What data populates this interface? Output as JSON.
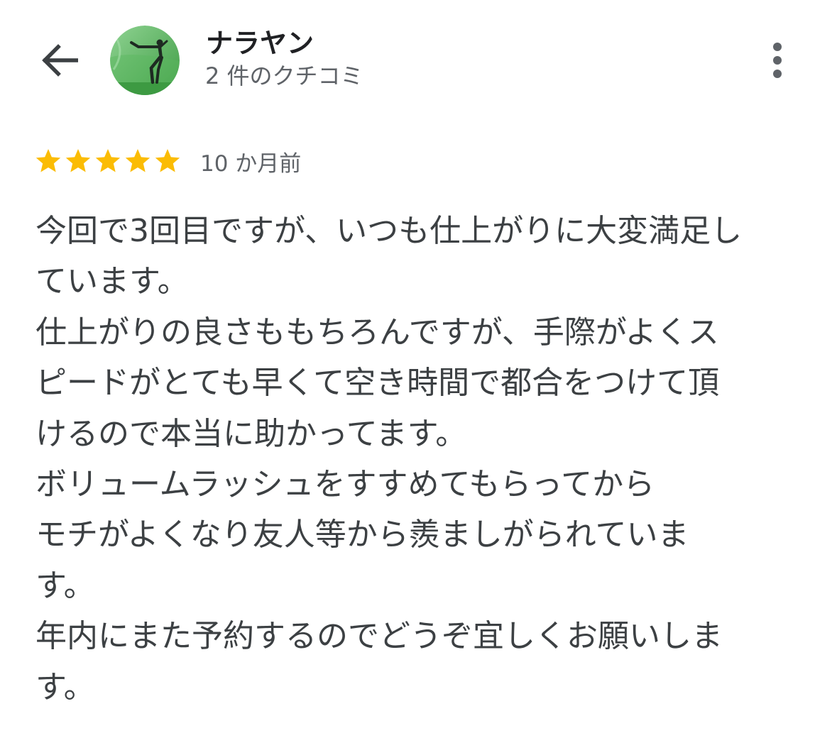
{
  "header": {
    "reviewer_name": "ナラヤン",
    "review_count": "2 件のクチコミ",
    "back_icon": "arrow-back-icon",
    "menu_icon": "more-vert-icon"
  },
  "review": {
    "rating": 5,
    "rating_max": 5,
    "star_color": "#fbbc04",
    "date": "10 か月前",
    "lines": [
      "今回で3回目ですが、いつも仕上がりに大変満足し",
      "ています。",
      "仕上がりの良さももちろんですが、手際がよくス",
      "ピードがとても早くて空き時間で都合をつけて頂",
      "けるので本当に助かってます。",
      "ボリュームラッシュをすすめてもらってから",
      "モチがよくなり友人等から羨ましがられていま",
      "す。",
      "年内にまた予約するのでどうぞ宜しくお願いしま",
      "す。"
    ]
  },
  "colors": {
    "text_primary": "#202124",
    "text_secondary": "#5f6368",
    "body_text": "#3c4043",
    "avatar_green": "#4caf50"
  }
}
